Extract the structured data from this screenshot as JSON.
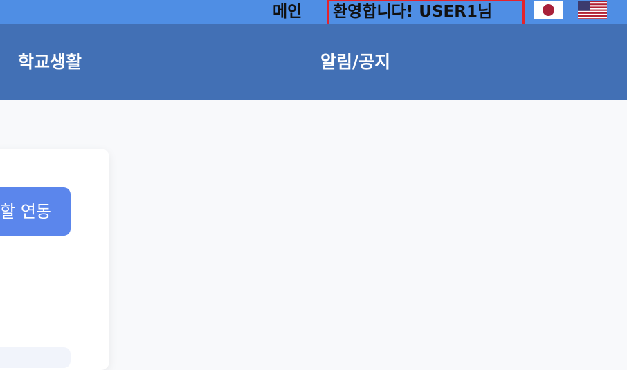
{
  "topbar": {
    "main_label": "메인",
    "welcome_text": "환영합니다! USER1님",
    "flags": [
      {
        "icon": "japan-flag-icon"
      },
      {
        "icon": "us-flag-icon"
      }
    ],
    "highlight_color": "#e5232b",
    "background_color": "#4f8ee4"
  },
  "navbar": {
    "items": [
      {
        "label": "학교생활"
      },
      {
        "label": "알림/공지"
      }
    ],
    "background_color": "#4270b5"
  },
  "card": {
    "link_button_label": "할 연동",
    "button_color": "#5b86ec"
  }
}
